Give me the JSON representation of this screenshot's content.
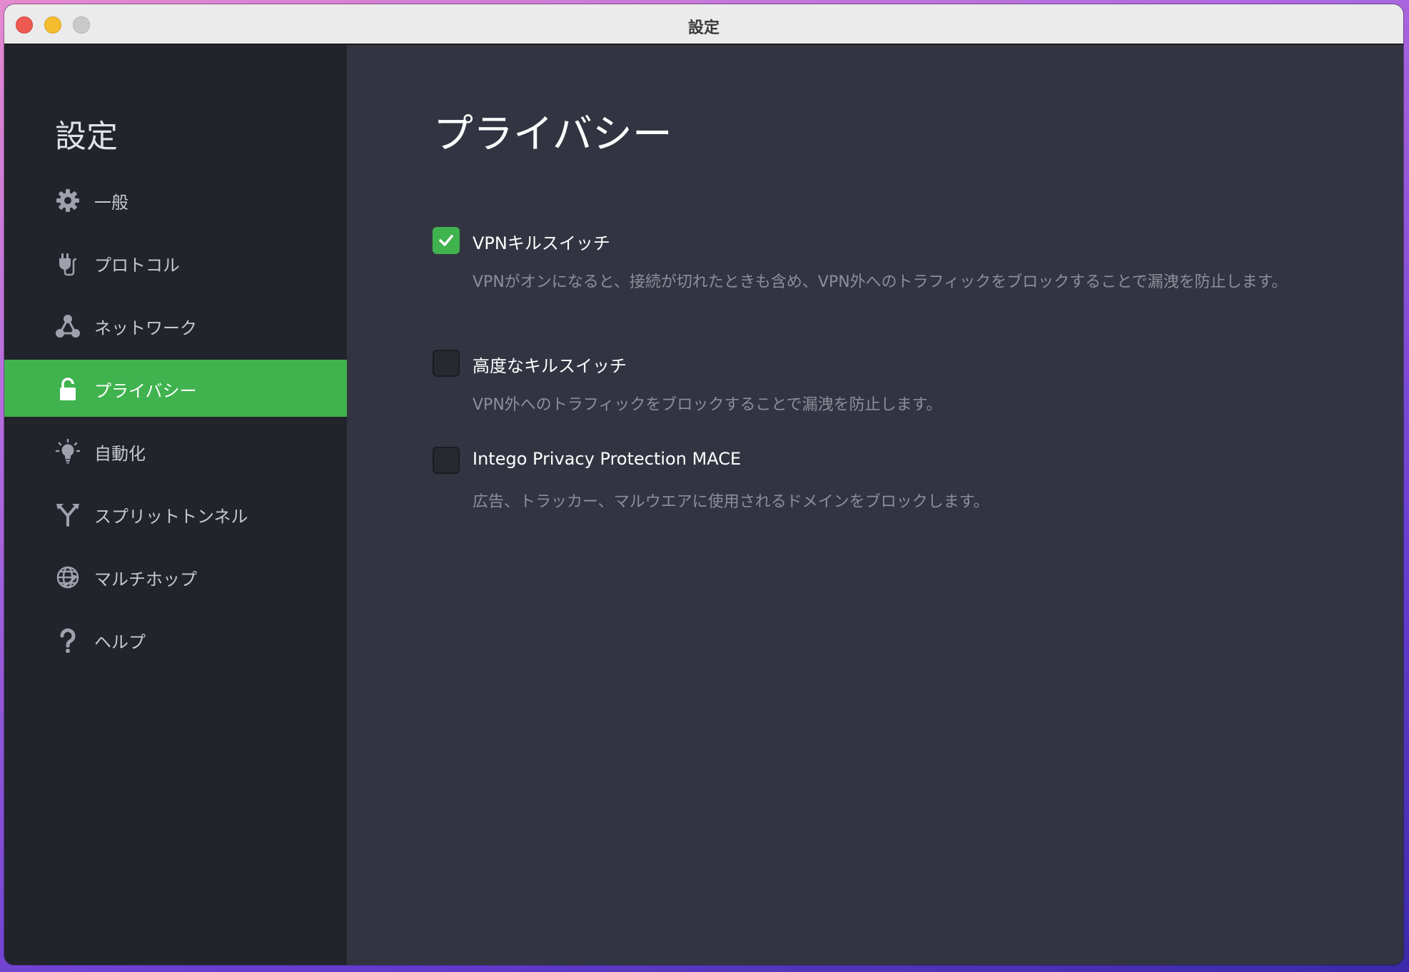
{
  "window": {
    "title": "設定"
  },
  "sidebar": {
    "title": "設定",
    "items": [
      {
        "label": "一般",
        "icon": "gear-icon",
        "active": false
      },
      {
        "label": "プロトコル",
        "icon": "plug-icon",
        "active": false
      },
      {
        "label": "ネットワーク",
        "icon": "network-icon",
        "active": false
      },
      {
        "label": "プライバシー",
        "icon": "lock-icon",
        "active": true
      },
      {
        "label": "自動化",
        "icon": "lightbulb-icon",
        "active": false
      },
      {
        "label": "スプリットトンネル",
        "icon": "split-icon",
        "active": false
      },
      {
        "label": "マルチホップ",
        "icon": "globe-icon",
        "active": false
      },
      {
        "label": "ヘルプ",
        "icon": "question-icon",
        "active": false
      }
    ]
  },
  "main": {
    "title": "プライバシー",
    "options": [
      {
        "label": "VPNキルスイッチ",
        "checked": true,
        "description": "VPNがオンになると、接続が切れたときも含め、VPN外へのトラフィックをブロックすることで漏洩を防止します。"
      },
      {
        "label": "高度なキルスイッチ",
        "checked": false,
        "description": "VPN外へのトラフィックをブロックすることで漏洩を防止します。"
      },
      {
        "label": "Intego Privacy Protection MACE",
        "checked": false,
        "description": "広告、トラッカー、マルウエアに使用されるドメインをブロックします。"
      }
    ]
  },
  "colors": {
    "accent": "#40b34f",
    "sidebar_bg": "#22242c",
    "main_bg": "#323541",
    "description_text": "#8c8f9a"
  }
}
